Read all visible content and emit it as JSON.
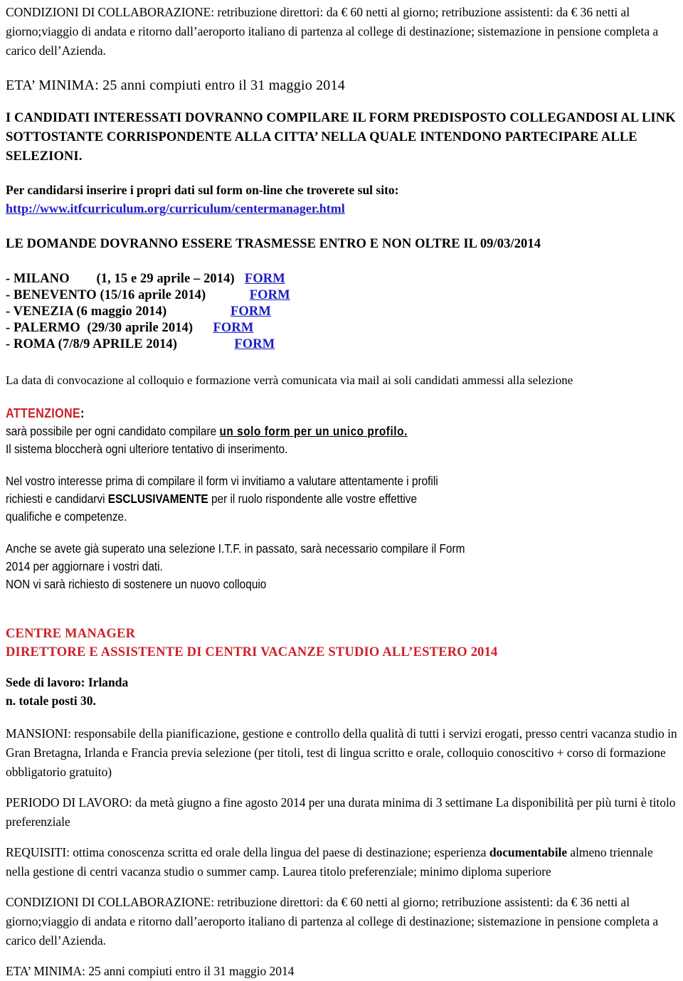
{
  "document": {
    "top_section": {
      "conditions_paragraph": "CONDIZIONI DI COLLABORAZIONE: retribuzione direttori:  da € 60 netti al giorno; retribuzione assistenti: da € 36 netti al giorno;viaggio di andata e ritorno dall’aeroporto italiano di partenza al college di destinazione; sistemazione in pensione completa a carico dell’Azienda.",
      "age_requirement": "ETA’ MINIMA: 25 anni compiuti entro il 31 maggio 2014",
      "instructions_heading": "I CANDIDATI INTERESSATI DOVRANNO COMPILARE IL  FORM PREDISPOSTO  COLLEGANDOSI AL LINK SOTTOSTANTE CORRISPONDENTE ALLA CITTA’ NELLA QUALE INTENDONO PARTECIPARE ALLE SELEZIONI.",
      "apply_intro": "Per candidarsi inserire i propri dati sul form on-line che troverete sul sito:",
      "apply_url": "http://www.itfcurriculum.org/curriculum/centermanager.html",
      "deadline": "LE DOMANDE DOVRANNO ESSERE  TRASMESSE ENTRO E NON OLTRE IL   09/03/2014"
    },
    "cities": [
      {
        "label": "- MILANO        (1, 15 e 29 aprile – 2014)   ",
        "link": "FORM"
      },
      {
        "label": "- BENEVENTO (15/16 aprile 2014)             ",
        "link": "FORM"
      },
      {
        "label": "- VENEZIA (6 maggio 2014)                   ",
        "link": "FORM"
      },
      {
        "label": "- PALERMO  (29/30 aprile 2014)      ",
        "link": "FORM"
      },
      {
        "label": "- ROMA (7/8/9 APRILE 2014)                 ",
        "link": "FORM"
      }
    ],
    "notice_section": {
      "convocation_note": "La data di convocazione al colloquio  e formazione verrà comunicata via mail ai soli  candidati ammessi alla selezione",
      "attention_label": "ATTENZIONE",
      "attention_colon": ":",
      "rule_line_prefix": "sarà possibile per ogni candidato compilare ",
      "rule_line_emphasis": "un solo form per un unico profilo.",
      "rule_line_second": "Il sistema bloccherà ogni ulteriore tentativo di inserimento.",
      "advice_line1_a": "Nel vostro interesse prima di compilare il form vi invitiamo a valutare attentamente i profili",
      "advice_line2_a": "richiesti e candidarvi ",
      "advice_line2_bold": "ESCLUSIVAMENTE",
      "advice_line2_b": " per il ruolo rispondente alle vostre effettive",
      "advice_line3": "qualifiche e competenze.",
      "past_line1": "Anche se avete già superato una selezione I.T.F. in passato, sarà necessario compilare il Form",
      "past_line2": "2014 per aggiornare i vostri dati.",
      "past_line3": "NON vi sarà richiesto di sostenere un nuovo colloquio"
    },
    "job_posting": {
      "title": "CENTRE MANAGER",
      "subtitle": "DIRETTORE E ASSISTENTE DI CENTRI VACANZE STUDIO ALL’ESTERO 2014",
      "location": "Sede di lavoro: Irlanda",
      "positions": "n. totale posti 30.",
      "duties": "MANSIONI: responsabile della pianificazione, gestione e controllo della qualità di tutti i servizi erogati, presso centri vacanza studio in Gran Bretagna, Irlanda e Francia previa selezione (per titoli, test di lingua scritto e orale, colloquio conoscitivo + corso di formazione obbligatorio gratuito)",
      "work_period": "PERIODO DI LAVORO: da metà giugno a fine agosto  2014 per una durata minima di 3 settimane La disponibilità per più turni è titolo preferenziale",
      "requirements_a": "REQUISITI: ottima conoscenza scritta ed orale della lingua del paese di destinazione; esperienza ",
      "requirements_bold": "documentabile",
      "requirements_b": " almeno triennale nella gestione di centri vacanza studio o summer camp. Laurea titolo preferenziale; minimo diploma superiore",
      "conditions_paragraph": "CONDIZIONI DI COLLABORAZIONE: retribuzione direttori:  da € 60 netti al giorno; retribuzione assistenti: da € 36 netti al giorno;viaggio di andata e ritorno dall’aeroporto italiano di partenza al college di destinazione; sistemazione in pensione completa a carico dell’Azienda.",
      "age_requirement": "ETA’ MINIMA: 25 anni compiuti entro il 31 maggio 2014"
    },
    "colors": {
      "accent_red": "#CC2026",
      "link_blue": "#1B1BC4",
      "text": "#000000",
      "background": "#FFFFFF"
    }
  }
}
